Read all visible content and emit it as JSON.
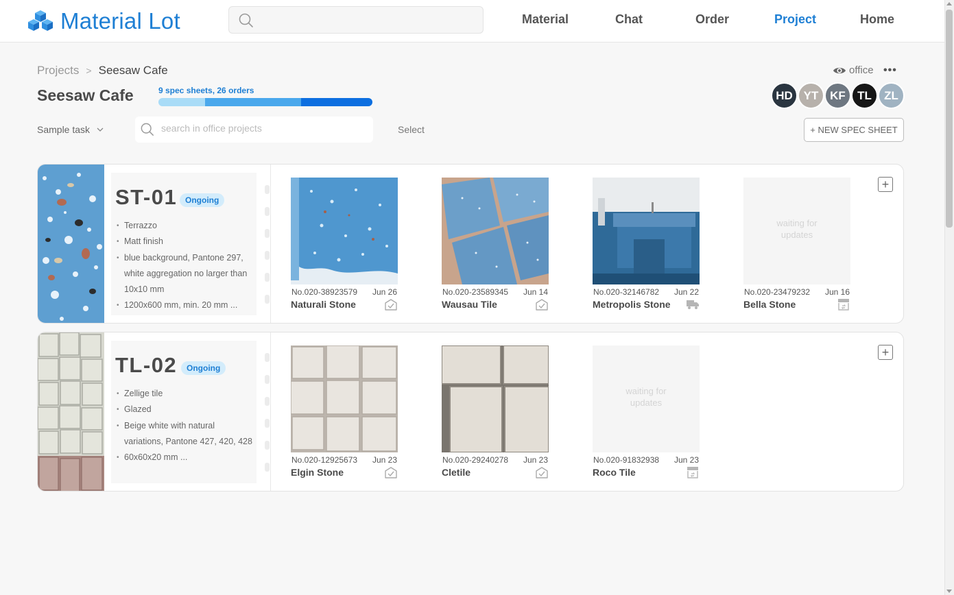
{
  "brand": {
    "name": "Material Lot"
  },
  "header": {
    "search_placeholder": "",
    "nav": [
      "Material",
      "Chat",
      "Order",
      "Project",
      "Home"
    ],
    "active_nav": "Project"
  },
  "breadcrumb": {
    "parent": "Projects",
    "separator": ">",
    "current": "Seesaw Cafe"
  },
  "project": {
    "title": "Seesaw Cafe",
    "progress_label": "9 spec sheets, 26 orders",
    "progress_fraction": 0.68
  },
  "visibility": {
    "icon": "eye-icon",
    "label": "office"
  },
  "more": {
    "icon": "more-icon"
  },
  "avatars": [
    "HD",
    "YT",
    "KF",
    "TL",
    "ZL"
  ],
  "toolbar": {
    "sample_task": "Sample task",
    "search_placeholder": "search in office projects",
    "select_label": "Select",
    "new_spec_label": "+ NEW SPEC SHEET"
  },
  "specs": [
    {
      "code": "ST-01",
      "status": "Ongoing",
      "details": [
        "Terrazzo",
        "Matt finish",
        "blue background, Pantone 297, white aggregation no larger than 10x10 mm",
        "1200x600 mm, min. 20 mm ..."
      ],
      "items": [
        {
          "number": "No.020-38923579",
          "date": "Jun 26",
          "name": "Naturali Stone",
          "status_icon": "approved-icon",
          "waiting": ""
        },
        {
          "number": "No.020-23589345",
          "date": "Jun 14",
          "name": "Wausau Tile",
          "status_icon": "approved-icon",
          "waiting": ""
        },
        {
          "number": "No.020-32146782",
          "date": "Jun 22",
          "name": "Metropolis Stone",
          "status_icon": "truck-icon",
          "waiting": ""
        },
        {
          "number": "No.020-23479232",
          "date": "Jun 16",
          "name": "Bella Stone",
          "status_icon": "shop-icon",
          "waiting": "waiting for updates"
        }
      ]
    },
    {
      "code": "TL-02",
      "status": "Ongoing",
      "details": [
        "Zellige tile",
        "Glazed",
        "Beige white with natural variations, Pantone 427,  420, 428",
        "60x60x20 mm ..."
      ],
      "items": [
        {
          "number": "No.020-12925673",
          "date": "Jun 23",
          "name": "Elgin Stone",
          "status_icon": "approved-icon",
          "waiting": ""
        },
        {
          "number": "No.020-29240278",
          "date": "Jun 23",
          "name": "Cletile",
          "status_icon": "approved-icon",
          "waiting": ""
        },
        {
          "number": "No.020-91832938",
          "date": "Jun 23",
          "name": "Roco Tile",
          "status_icon": "shop-icon",
          "waiting": "waiting for updates"
        }
      ]
    }
  ],
  "colors": {
    "accent": "#1e7fd4",
    "badge_bg": "#d3ecfb"
  }
}
